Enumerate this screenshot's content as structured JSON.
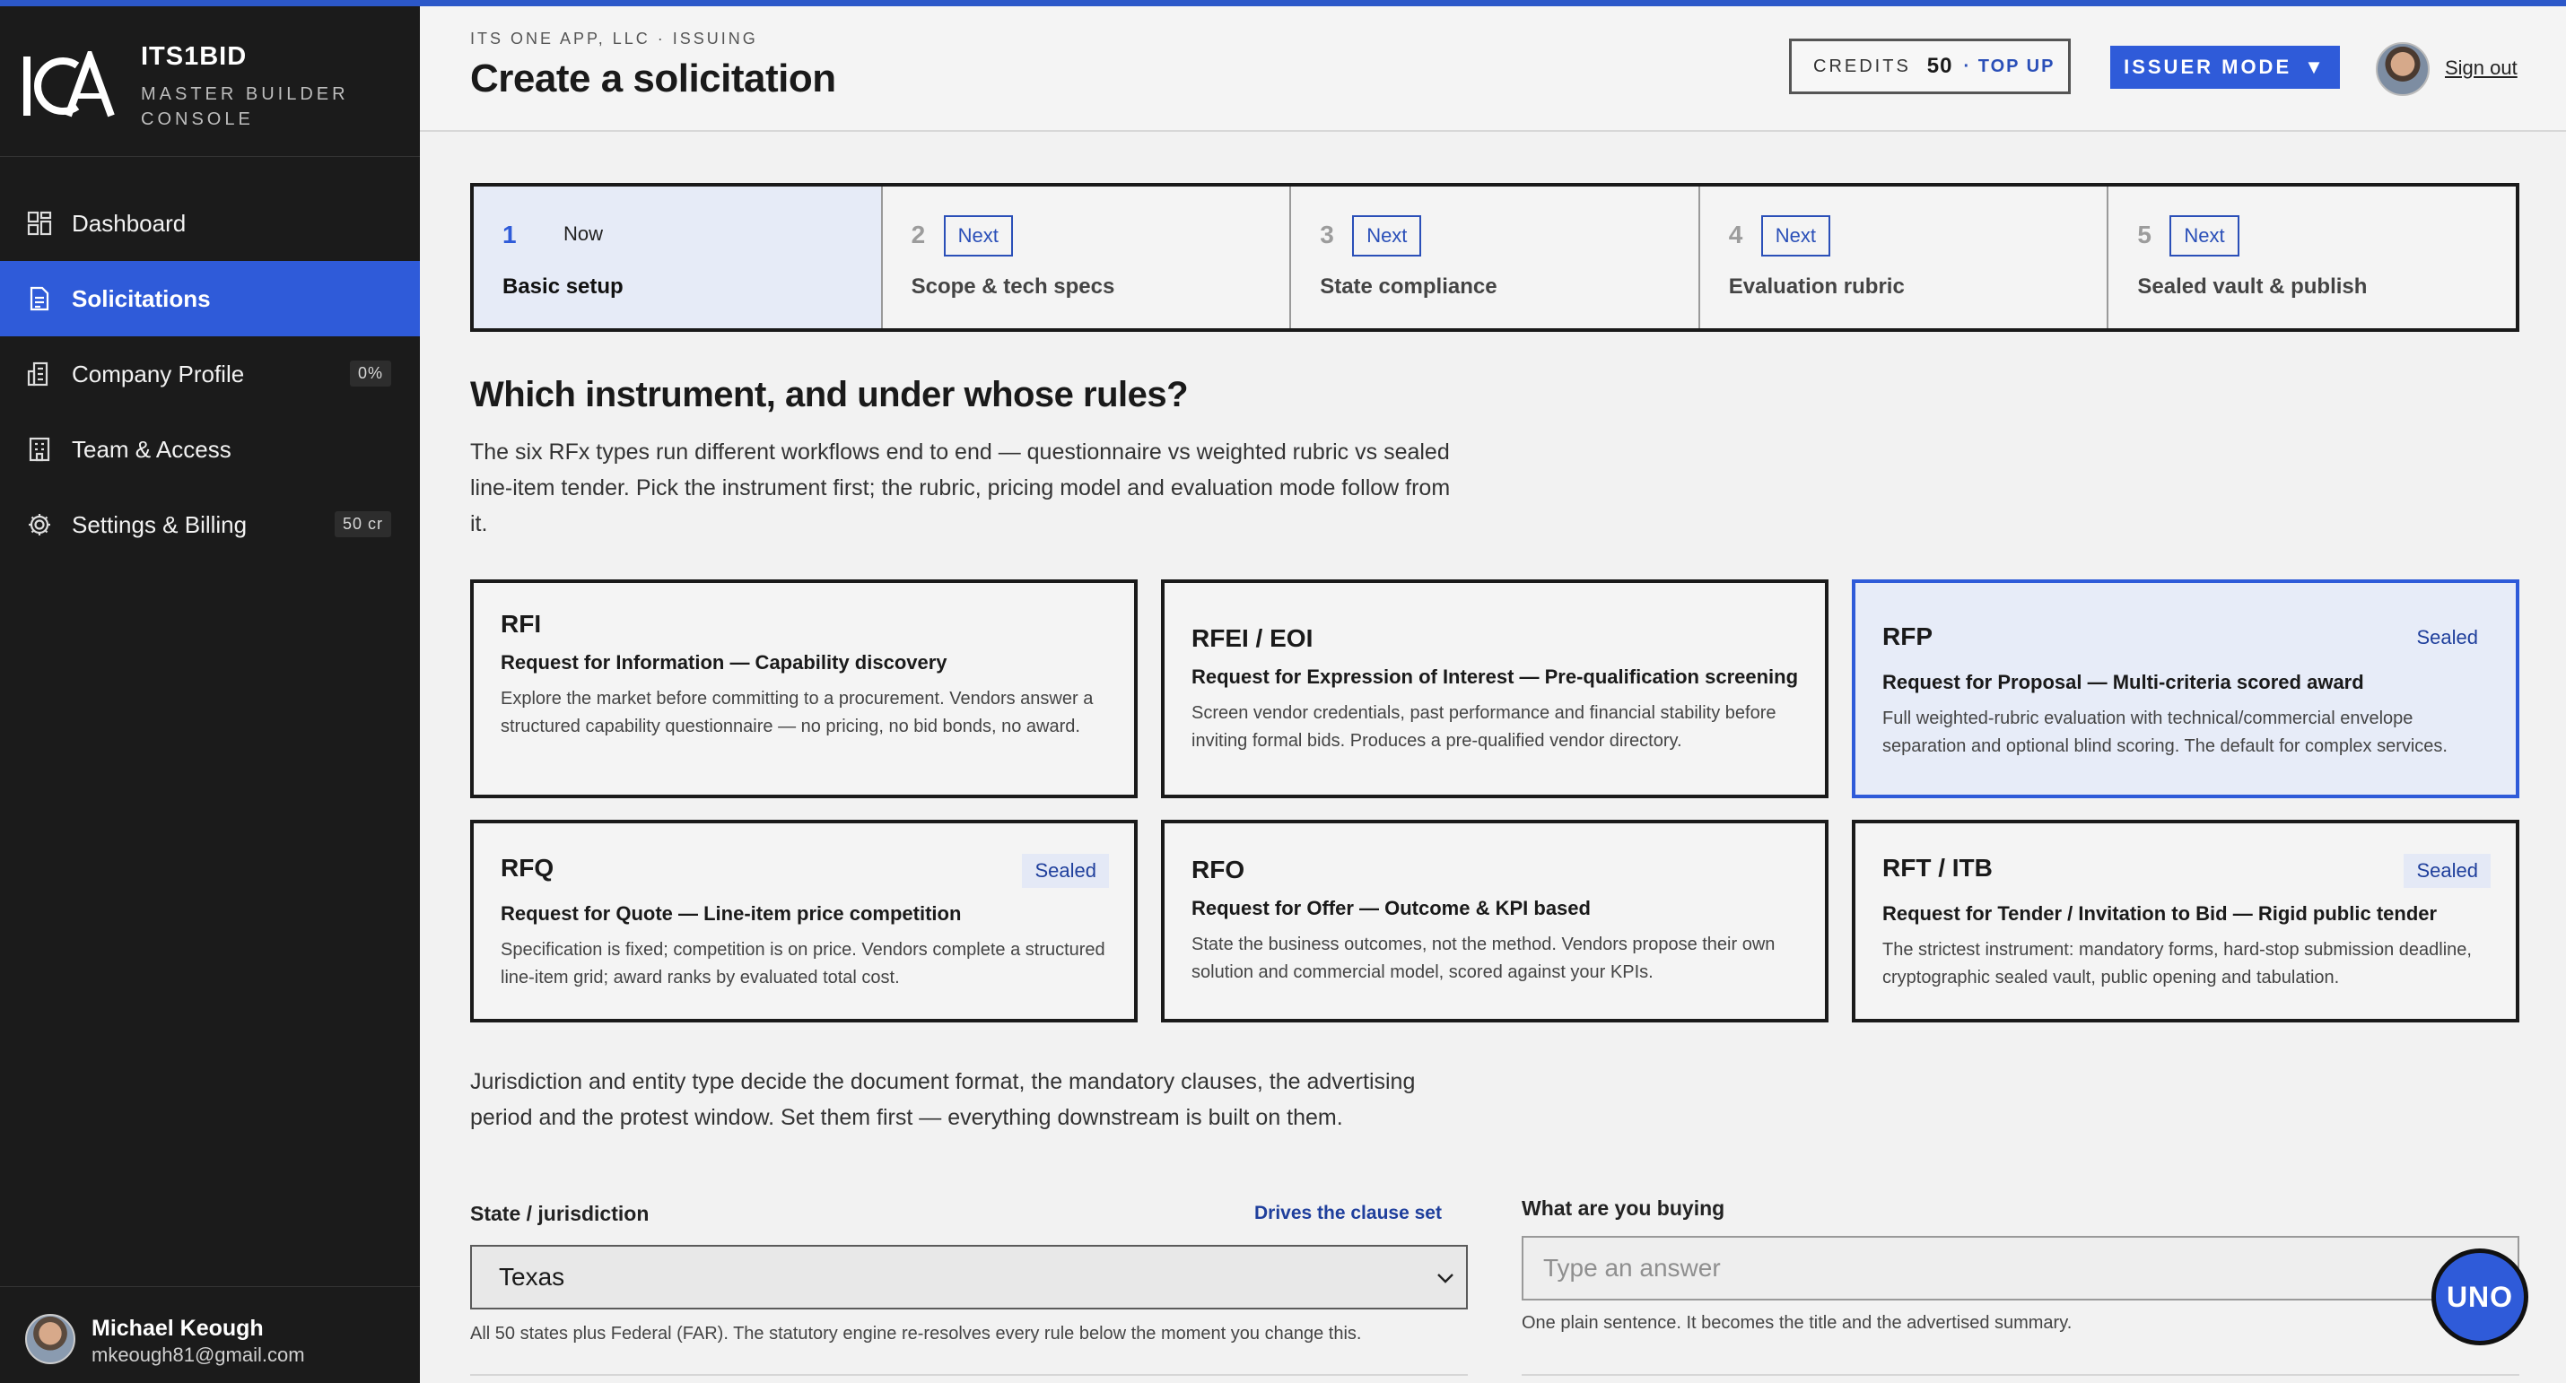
{
  "brand": {
    "name": "ITS1BID",
    "subtitle": "MASTER BUILDER CONSOLE"
  },
  "sidebar": {
    "items": [
      {
        "label": "Dashboard",
        "icon": "grid-icon",
        "badge": ""
      },
      {
        "label": "Solicitations",
        "icon": "document-icon",
        "badge": "",
        "active": true
      },
      {
        "label": "Company Profile",
        "icon": "building-icon",
        "badge": "0%"
      },
      {
        "label": "Team & Access",
        "icon": "office-icon",
        "badge": ""
      },
      {
        "label": "Settings & Billing",
        "icon": "gear-icon",
        "badge": "50 cr"
      }
    ],
    "user": {
      "name": "Michael Keough",
      "email": "mkeough81@gmail.com"
    }
  },
  "header": {
    "breadcrumb": "ITS ONE APP, LLC · ISSUING",
    "title": "Create a solicitation",
    "credits_label": "CREDITS",
    "credits_value": "50",
    "top_up": "· TOP UP",
    "mode_button": "ISSUER MODE",
    "sign_out": "Sign out"
  },
  "stepper": [
    {
      "num": "1",
      "status": "Now",
      "label": "Basic setup",
      "current": true
    },
    {
      "num": "2",
      "status": "Next",
      "label": "Scope & tech specs"
    },
    {
      "num": "3",
      "status": "Next",
      "label": "State compliance"
    },
    {
      "num": "4",
      "status": "Next",
      "label": "Evaluation rubric"
    },
    {
      "num": "5",
      "status": "Next",
      "label": "Sealed vault & publish"
    }
  ],
  "instrument": {
    "title": "Which instrument, and under whose rules?",
    "description": "The six RFx types run different workflows end to end — questionnaire vs weighted rubric vs sealed line-item tender. Pick the instrument first; the rubric, pricing model and evaluation mode follow from it.",
    "cards": [
      {
        "code": "RFI",
        "subtitle": "Request for Information — Capability discovery",
        "description": "Explore the market before committing to a procurement. Vendors answer a structured capability questionnaire — no pricing, no bid bonds, no award.",
        "badge": ""
      },
      {
        "code": "RFEI / EOI",
        "subtitle": "Request for Expression of Interest — Pre-qualification screening",
        "description": "Screen vendor credentials, past performance and financial stability before inviting formal bids. Produces a pre-qualified vendor directory.",
        "badge": ""
      },
      {
        "code": "RFP",
        "subtitle": "Request for Proposal — Multi-criteria scored award",
        "description": "Full weighted-rubric evaluation with technical/commercial envelope separation and optional blind scoring. The default for complex services.",
        "badge": "Sealed",
        "selected": true
      },
      {
        "code": "RFQ",
        "subtitle": "Request for Quote — Line-item price competition",
        "description": "Specification is fixed; competition is on price. Vendors complete a structured line-item grid; award ranks by evaluated total cost.",
        "badge": "Sealed"
      },
      {
        "code": "RFO",
        "subtitle": "Request for Offer — Outcome & KPI based",
        "description": "State the business outcomes, not the method. Vendors propose their own solution and commercial model, scored against your KPIs.",
        "badge": ""
      },
      {
        "code": "RFT / ITB",
        "subtitle": "Request for Tender / Invitation to Bid — Rigid public tender",
        "description": "The strictest instrument: mandatory forms, hard-stop submission deadline, cryptographic sealed vault, public opening and tabulation.",
        "badge": "Sealed"
      }
    ]
  },
  "jurisdiction": {
    "description": "Jurisdiction and entity type decide the document format, the mandatory clauses, the advertising period and the protest window. Set them first — everything downstream is built on them.",
    "state_label": "State / jurisdiction",
    "state_hint": "Drives the clause set",
    "state_value": "Texas",
    "state_note": "All 50 states plus Federal (FAR). The statutory engine re-resolves every rule below the moment you change this.",
    "buying_label": "What are you buying",
    "buying_placeholder": "Type an answer",
    "buying_note": "One plain sentence. It becomes the title and the advertised summary."
  },
  "assistant": {
    "label": "UNO"
  },
  "colors": {
    "accent": "#2f5bd9",
    "sidebar": "#1b1b1b",
    "badge_text": "#1f3f9c"
  }
}
